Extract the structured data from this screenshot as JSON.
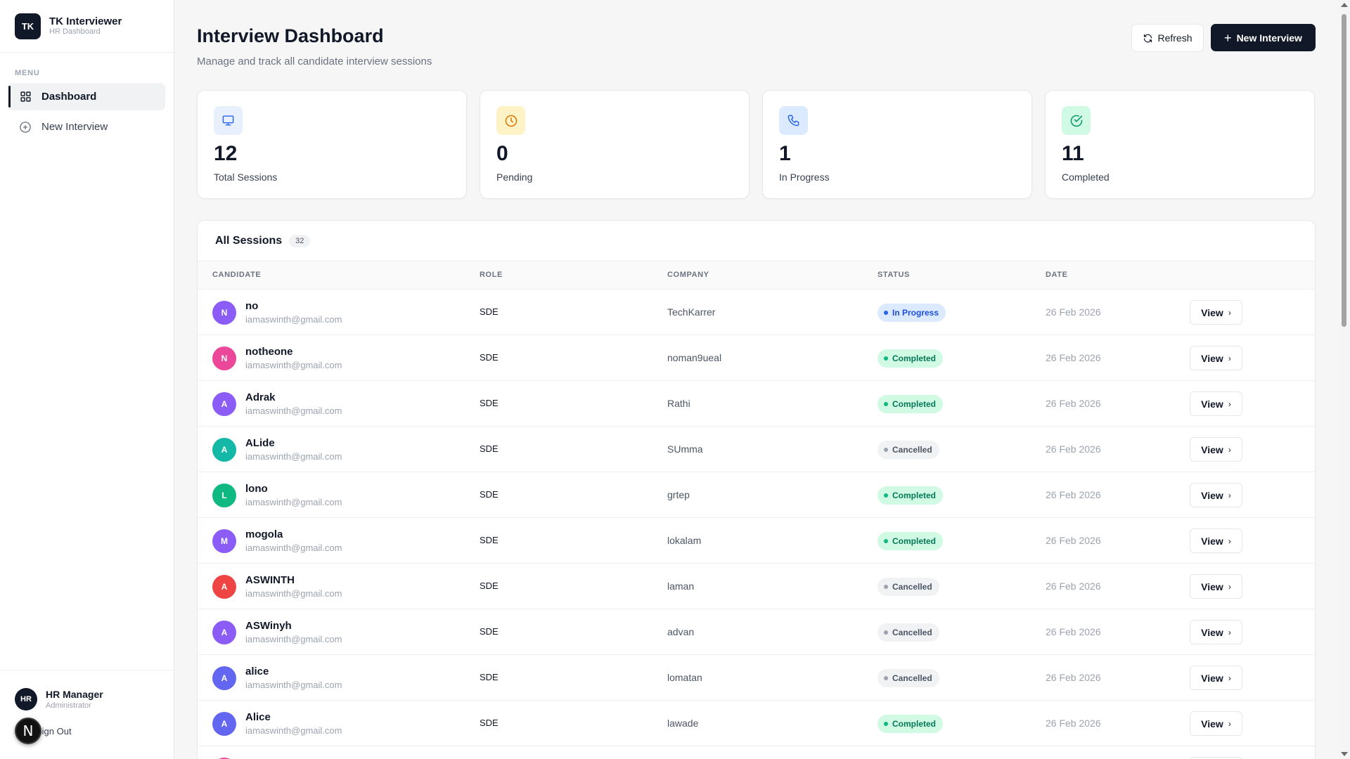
{
  "brand": {
    "logo": "TK",
    "name": "TK Interviewer",
    "subtitle": "HR Dashboard"
  },
  "sidebar": {
    "menu_label": "MENU",
    "items": [
      {
        "label": "Dashboard",
        "icon": "grid-icon",
        "active": true
      },
      {
        "label": "New Interview",
        "icon": "plus-circle-icon",
        "active": false
      }
    ]
  },
  "user": {
    "initials": "HR",
    "name": "HR Manager",
    "role": "Administrator",
    "signout_label": "Sign Out",
    "overlay_badge": "N"
  },
  "header": {
    "title": "Interview Dashboard",
    "subtitle": "Manage and track all candidate interview sessions",
    "refresh_label": "Refresh",
    "new_interview_label": "New Interview"
  },
  "stats": [
    {
      "value": "12",
      "label": "Total Sessions",
      "icon": "monitor-icon",
      "bg": "#e8f0fe",
      "color": "#2563eb"
    },
    {
      "value": "0",
      "label": "Pending",
      "icon": "clock-icon",
      "bg": "#fef3c7",
      "color": "#d97706"
    },
    {
      "value": "1",
      "label": "In Progress",
      "icon": "phone-icon",
      "bg": "#dbeafe",
      "color": "#2563eb"
    },
    {
      "value": "11",
      "label": "Completed",
      "icon": "check-circle-icon",
      "bg": "#d1fae5",
      "color": "#059669"
    }
  ],
  "sessions": {
    "title": "All Sessions",
    "count": "32",
    "columns": [
      "CANDIDATE",
      "ROLE",
      "COMPANY",
      "STATUS",
      "DATE"
    ],
    "view_label": "View",
    "rows": [
      {
        "initial": "N",
        "color": "#8b5cf6",
        "name": "no",
        "email": "iamaswinth@gmail.com",
        "role": "SDE",
        "company": "TechKarrer",
        "status": "In Progress",
        "status_class": "in-progress",
        "date": "26 Feb 2026"
      },
      {
        "initial": "N",
        "color": "#ec4899",
        "name": "notheone",
        "email": "iamaswinth@gmail.com",
        "role": "SDE",
        "company": "noman9ueal",
        "status": "Completed",
        "status_class": "completed",
        "date": "26 Feb 2026"
      },
      {
        "initial": "A",
        "color": "#8b5cf6",
        "name": "Adrak",
        "email": "iamaswinth@gmail.com",
        "role": "SDE",
        "company": "Rathi",
        "status": "Completed",
        "status_class": "completed",
        "date": "26 Feb 2026"
      },
      {
        "initial": "A",
        "color": "#14b8a6",
        "name": "ALide",
        "email": "iamaswinth@gmail.com",
        "role": "SDE",
        "company": "SUmma",
        "status": "Cancelled",
        "status_class": "cancelled",
        "date": "26 Feb 2026"
      },
      {
        "initial": "L",
        "color": "#10b981",
        "name": "lono",
        "email": "iamaswinth@gmail.com",
        "role": "SDE",
        "company": "grtep",
        "status": "Completed",
        "status_class": "completed",
        "date": "26 Feb 2026"
      },
      {
        "initial": "M",
        "color": "#8b5cf6",
        "name": "mogola",
        "email": "iamaswinth@gmail.com",
        "role": "SDE",
        "company": "lokalam",
        "status": "Completed",
        "status_class": "completed",
        "date": "26 Feb 2026"
      },
      {
        "initial": "A",
        "color": "#ef4444",
        "name": "ASWINTH",
        "email": "iamaswinth@gmail.com",
        "role": "SDE",
        "company": "laman",
        "status": "Cancelled",
        "status_class": "cancelled",
        "date": "26 Feb 2026"
      },
      {
        "initial": "A",
        "color": "#8b5cf6",
        "name": "ASWinyh",
        "email": "iamaswinth@gmail.com",
        "role": "SDE",
        "company": "advan",
        "status": "Cancelled",
        "status_class": "cancelled",
        "date": "26 Feb 2026"
      },
      {
        "initial": "A",
        "color": "#6366f1",
        "name": "alice",
        "email": "iamaswinth@gmail.com",
        "role": "SDE",
        "company": "lomatan",
        "status": "Cancelled",
        "status_class": "cancelled",
        "date": "26 Feb 2026"
      },
      {
        "initial": "A",
        "color": "#6366f1",
        "name": "Alice",
        "email": "iamaswinth@gmail.com",
        "role": "SDE",
        "company": "lawade",
        "status": "Completed",
        "status_class": "completed",
        "date": "26 Feb 2026"
      },
      {
        "initial": "",
        "color": "#ec4899",
        "name": "",
        "email": "",
        "role": "",
        "company": "",
        "status": "",
        "status_class": "completed",
        "date": ""
      }
    ]
  }
}
